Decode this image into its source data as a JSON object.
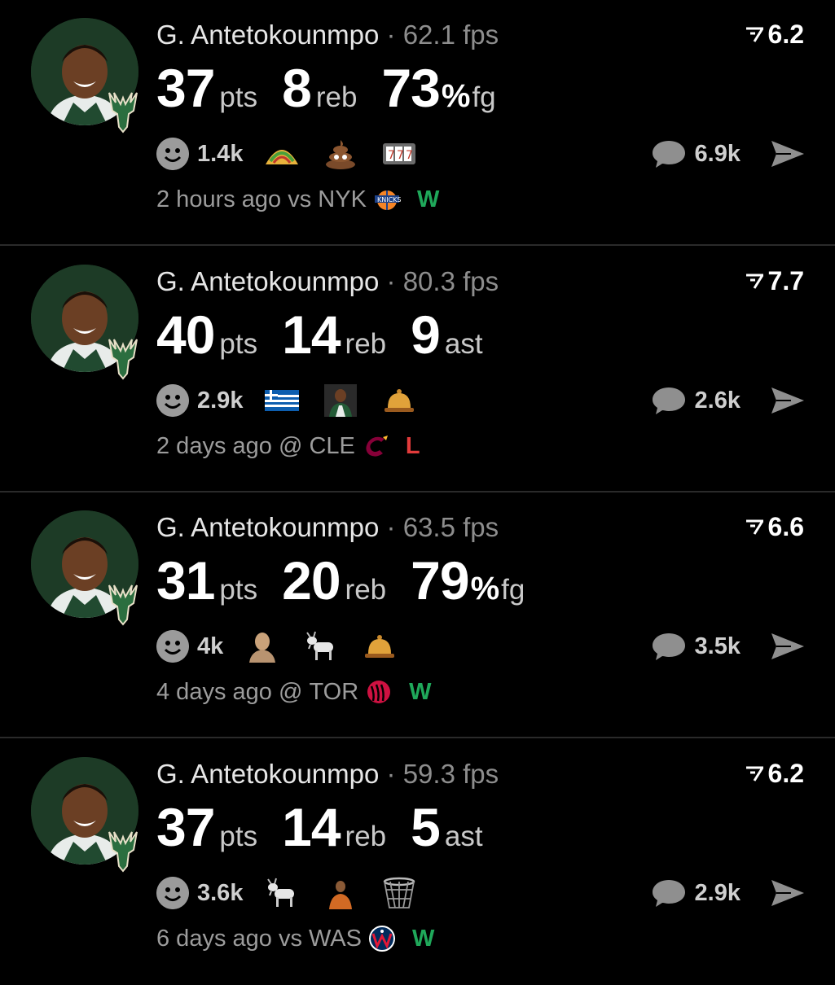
{
  "colors": {
    "win": "#1fa85a",
    "loss": "#e23b3b",
    "muted": "#8d8d8d"
  },
  "posts": [
    {
      "player": "G. Antetokounmpo",
      "separator": "·",
      "fps": "62.1 fps",
      "rating": "6.2",
      "stats": [
        {
          "value": "37",
          "unit": "pts"
        },
        {
          "value": "8",
          "unit": "reb"
        },
        {
          "value": "73",
          "pct": "%",
          "unit": "fg"
        }
      ],
      "reactions": {
        "count": "1.4k",
        "emojis": [
          "taco-emoji",
          "poop-emoji",
          "slot-machine-emoji"
        ]
      },
      "comments": "6.9k",
      "time": "2 hours ago",
      "venue": "vs",
      "opponent": "NYK",
      "opponent_logo": "knicks-logo",
      "result": "W"
    },
    {
      "player": "G. Antetokounmpo",
      "separator": "·",
      "fps": "80.3 fps",
      "rating": "7.7",
      "stats": [
        {
          "value": "40",
          "unit": "pts"
        },
        {
          "value": "14",
          "unit": "reb"
        },
        {
          "value": "9",
          "unit": "ast"
        }
      ],
      "reactions": {
        "count": "2.9k",
        "emojis": [
          "greece-flag-emoji",
          "player-emoji",
          "bell-emoji"
        ]
      },
      "comments": "2.6k",
      "time": "2 days ago",
      "venue": "@",
      "opponent": "CLE",
      "opponent_logo": "cavaliers-logo",
      "result": "L"
    },
    {
      "player": "G. Antetokounmpo",
      "separator": "·",
      "fps": "63.5 fps",
      "rating": "6.6",
      "stats": [
        {
          "value": "31",
          "unit": "pts"
        },
        {
          "value": "20",
          "unit": "reb"
        },
        {
          "value": "79",
          "pct": "%",
          "unit": "fg"
        }
      ],
      "reactions": {
        "count": "4k",
        "emojis": [
          "bald-head-emoji",
          "goat-emoji",
          "bell-emoji"
        ]
      },
      "comments": "3.5k",
      "time": "4 days ago",
      "venue": "@",
      "opponent": "TOR",
      "opponent_logo": "raptors-logo",
      "result": "W"
    },
    {
      "player": "G. Antetokounmpo",
      "separator": "·",
      "fps": "59.3 fps",
      "rating": "6.2",
      "stats": [
        {
          "value": "37",
          "unit": "pts"
        },
        {
          "value": "14",
          "unit": "reb"
        },
        {
          "value": "5",
          "unit": "ast"
        }
      ],
      "reactions": {
        "count": "3.6k",
        "emojis": [
          "goat-emoji",
          "person-emoji",
          "basketball-net-emoji"
        ]
      },
      "comments": "2.9k",
      "time": "6 days ago",
      "venue": "vs",
      "opponent": "WAS",
      "opponent_logo": "wizards-logo",
      "result": "W"
    }
  ]
}
